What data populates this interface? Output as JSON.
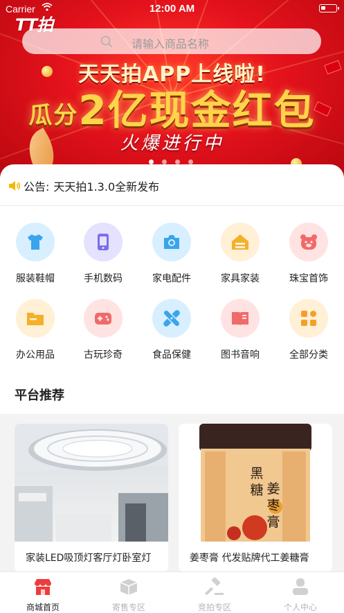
{
  "status_bar": {
    "carrier": "Carrier",
    "time": "12:00 AM"
  },
  "app": {
    "logo": "TT拍"
  },
  "search": {
    "placeholder": "请输入商品名称"
  },
  "banner": {
    "headline": "天天拍APP上线啦!",
    "line_prefix": "瓜分",
    "line_big": "2亿现金红包",
    "script": "火爆进行中",
    "slide_count": 4,
    "active_slide": 1
  },
  "notice": {
    "label": "公告:",
    "text": "天天拍1.3.0全新发布"
  },
  "categories": [
    {
      "label": "服装鞋帽",
      "icon": "shirt-icon",
      "color": "#d8efff",
      "icon_color": "#3aa4ec"
    },
    {
      "label": "手机数码",
      "icon": "phone-icon",
      "color": "#e4e2ff",
      "icon_color": "#7c6ee8"
    },
    {
      "label": "家电配件",
      "icon": "camera-icon",
      "color": "#d8efff",
      "icon_color": "#3aa4ec"
    },
    {
      "label": "家具家装",
      "icon": "house-icon",
      "color": "#fff0d6",
      "icon_color": "#f3b02a"
    },
    {
      "label": "珠宝首饰",
      "icon": "bear-icon",
      "color": "#ffe3e3",
      "icon_color": "#f06a6a"
    },
    {
      "label": "办公用品",
      "icon": "folder-icon",
      "color": "#fff0d6",
      "icon_color": "#f3b02a"
    },
    {
      "label": "古玩珍奇",
      "icon": "gamepad-icon",
      "color": "#ffe3e3",
      "icon_color": "#f06a6a"
    },
    {
      "label": "食品保健",
      "icon": "bandage-icon",
      "color": "#d8efff",
      "icon_color": "#3aa4ec"
    },
    {
      "label": "图书音响",
      "icon": "book-icon",
      "color": "#ffe3e3",
      "icon_color": "#f06a6a"
    },
    {
      "label": "全部分类",
      "icon": "grid-icon",
      "color": "#fff0d6",
      "icon_color": "#f3a02a"
    }
  ],
  "section": {
    "title": "平台推荐"
  },
  "products": [
    {
      "title": "家装LED吸顶灯客厅灯卧室灯"
    },
    {
      "title": "姜枣膏 代发贴牌代工姜糖膏"
    }
  ],
  "product_jar": {
    "label_lines": [
      "黑",
      "糖",
      "姜",
      "枣",
      "膏"
    ]
  },
  "tabs": [
    {
      "label": "商城首页",
      "icon": "shop-icon",
      "active": true
    },
    {
      "label": "寄售专区",
      "icon": "box-icon",
      "active": false
    },
    {
      "label": "竞拍专区",
      "icon": "gavel-icon",
      "active": false
    },
    {
      "label": "个人中心",
      "icon": "user-icon",
      "active": false
    }
  ],
  "colors": {
    "brand_red": "#e4121c",
    "active_tab": "#ef3b3b",
    "inactive_tab": "#cccccc"
  }
}
